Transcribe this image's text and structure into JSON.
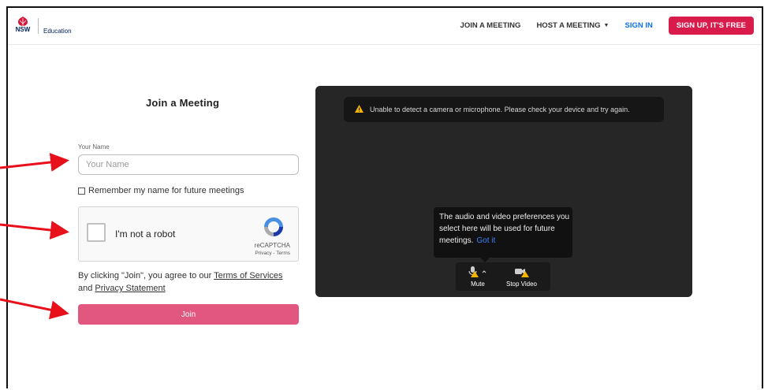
{
  "header": {
    "logo_text": "NSW",
    "logo_subtitle": "Education",
    "nav": {
      "join": "JOIN A MEETING",
      "host": "HOST A MEETING",
      "signin": "SIGN IN",
      "signup": "SIGN UP, IT'S FREE"
    }
  },
  "form": {
    "title": "Join a Meeting",
    "name_label": "Your Name",
    "name_placeholder": "Your Name",
    "name_value": "",
    "remember_label": "Remember my name for future meetings",
    "remember_checked": false,
    "recaptcha": {
      "label": "I'm not a robot",
      "brand": "reCAPTCHA",
      "privacy": "Privacy",
      "terms": "Terms"
    },
    "terms_prefix": "By clicking \"Join\", you agree to our ",
    "terms_link": "Terms of Services",
    "terms_and": " and ",
    "privacy_link": "Privacy Statement",
    "join_button": "Join"
  },
  "video": {
    "alert_text": "Unable to detect a camera or microphone. Please check your device and try again.",
    "tooltip_text": "The audio and video preferences you select here will be used for future meetings.",
    "tooltip_action": "Got it",
    "mute_label": "Mute",
    "stop_video_label": "Stop Video"
  },
  "colors": {
    "brand_red": "#d81b4b",
    "join_pink": "#e2577f",
    "link_blue": "#0e72ed",
    "arrow_red": "#e8101a",
    "warning_yellow": "#f5b400"
  },
  "icons": [
    "nsw-waratah-icon",
    "caret-down-icon",
    "recaptcha-icon",
    "warning-icon",
    "microphone-icon",
    "video-camera-icon"
  ]
}
